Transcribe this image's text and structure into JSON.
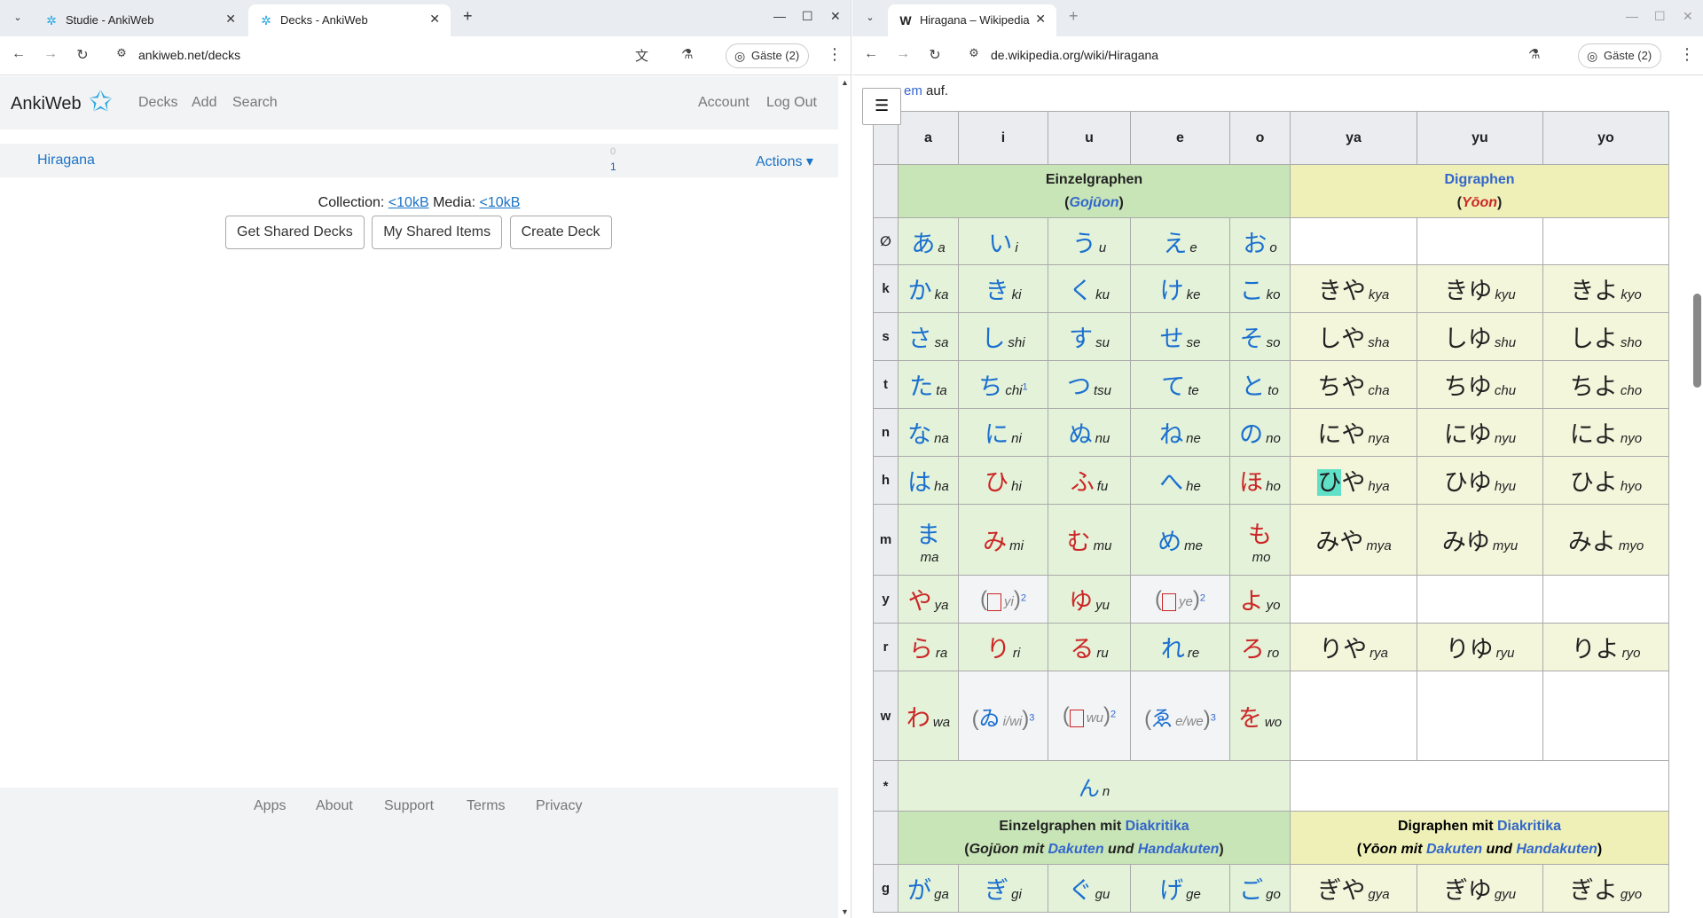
{
  "left_window": {
    "tabs": [
      {
        "title": "Studie - AnkiWeb",
        "active": false
      },
      {
        "title": "Decks - AnkiWeb",
        "active": true
      }
    ],
    "url": "ankiweb.net/decks",
    "profile": "Gäste (2)",
    "nav": {
      "logo": "AnkiWeb",
      "links": [
        "Decks",
        "Add",
        "Search"
      ],
      "right": [
        "Account",
        "Log Out"
      ]
    },
    "deck": {
      "name": "Hiragana",
      "count_top": "0",
      "count_bottom": "1",
      "actions": "Actions ▾"
    },
    "collection": {
      "label_collection": "Collection:",
      "collection_size": "<10kB",
      "label_media": "Media:",
      "media_size": "<10kB"
    },
    "buttons": [
      "Get Shared Decks",
      "My Shared Items",
      "Create Deck"
    ],
    "footer": [
      "Apps",
      "About",
      "Support",
      "Terms",
      "Privacy"
    ]
  },
  "right_window": {
    "tab": {
      "title": "Hiragana – Wikipedia"
    },
    "url": "de.wikipedia.org/wiki/Hiragana",
    "profile": "Gäste (2)",
    "pre_text_link": "em",
    "pre_text": " auf.",
    "table": {
      "columns": [
        "a",
        "i",
        "u",
        "e",
        "o",
        "ya",
        "yu",
        "yo"
      ],
      "group1": {
        "title": "Einzelgraphen",
        "sub": "Gojūon"
      },
      "group2": {
        "title": "Digraphen",
        "sub": "Yōon"
      },
      "rows": [
        {
          "label": "∅",
          "cells": [
            [
              "あ",
              "a",
              "b"
            ],
            [
              "い",
              "i",
              "b"
            ],
            [
              "う",
              "u",
              "b"
            ],
            [
              "え",
              "e",
              "b"
            ],
            [
              "お",
              "o",
              "b"
            ],
            null,
            null,
            null
          ]
        },
        {
          "label": "k",
          "cells": [
            [
              "か",
              "ka",
              "b"
            ],
            [
              "き",
              "ki",
              "b"
            ],
            [
              "く",
              "ku",
              "b"
            ],
            [
              "け",
              "ke",
              "b"
            ],
            [
              "こ",
              "ko",
              "b"
            ],
            [
              "きや",
              "kya",
              "k"
            ],
            [
              "きゆ",
              "kyu",
              "k"
            ],
            [
              "きよ",
              "kyo",
              "k"
            ]
          ]
        },
        {
          "label": "s",
          "cells": [
            [
              "さ",
              "sa",
              "b"
            ],
            [
              "し",
              "shi",
              "b"
            ],
            [
              "す",
              "su",
              "b"
            ],
            [
              "せ",
              "se",
              "b"
            ],
            [
              "そ",
              "so",
              "b"
            ],
            [
              "しや",
              "sha",
              "k"
            ],
            [
              "しゆ",
              "shu",
              "k"
            ],
            [
              "しよ",
              "sho",
              "k"
            ]
          ]
        },
        {
          "label": "t",
          "cells": [
            [
              "た",
              "ta",
              "b"
            ],
            [
              "ち",
              "chi",
              "b"
            ],
            [
              "つ",
              "tsu",
              "b"
            ],
            [
              "て",
              "te",
              "b"
            ],
            [
              "と",
              "to",
              "b"
            ],
            [
              "ちや",
              "cha",
              "k"
            ],
            [
              "ちゆ",
              "chu",
              "k"
            ],
            [
              "ちよ",
              "cho",
              "k"
            ]
          ]
        },
        {
          "label": "n",
          "cells": [
            [
              "な",
              "na",
              "b"
            ],
            [
              "に",
              "ni",
              "b"
            ],
            [
              "ぬ",
              "nu",
              "b"
            ],
            [
              "ね",
              "ne",
              "b"
            ],
            [
              "の",
              "no",
              "b"
            ],
            [
              "にや",
              "nya",
              "k"
            ],
            [
              "にゆ",
              "nyu",
              "k"
            ],
            [
              "によ",
              "nyo",
              "k"
            ]
          ]
        },
        {
          "label": "h",
          "cells": [
            [
              "は",
              "ha",
              "b"
            ],
            [
              "ひ",
              "hi",
              "r"
            ],
            [
              "ふ",
              "fu",
              "r"
            ],
            [
              "へ",
              "he",
              "b"
            ],
            [
              "ほ",
              "ho",
              "r"
            ],
            [
              "ひや",
              "hya",
              "k"
            ],
            [
              "ひゆ",
              "hyu",
              "k"
            ],
            [
              "ひよ",
              "hyo",
              "k"
            ]
          ]
        },
        {
          "label": "m",
          "cells": [
            [
              "ま",
              "ma",
              "b"
            ],
            [
              "み",
              "mi",
              "r"
            ],
            [
              "む",
              "mu",
              "r"
            ],
            [
              "め",
              "me",
              "b"
            ],
            [
              "も",
              "mo",
              "r"
            ],
            [
              "みや",
              "mya",
              "k"
            ],
            [
              "みゆ",
              "myu",
              "k"
            ],
            [
              "みよ",
              "myo",
              "k"
            ]
          ]
        },
        {
          "label": "y",
          "cells": [
            [
              "や",
              "ya",
              "r"
            ],
            [
              "yi",
              "yi",
              "g"
            ],
            [
              "ゆ",
              "yu",
              "r"
            ],
            [
              "ye",
              "ye",
              "g"
            ],
            [
              "よ",
              "yo",
              "r"
            ],
            null,
            null,
            null
          ]
        },
        {
          "label": "r",
          "cells": [
            [
              "ら",
              "ra",
              "r"
            ],
            [
              "り",
              "ri",
              "r"
            ],
            [
              "る",
              "ru",
              "r"
            ],
            [
              "れ",
              "re",
              "b"
            ],
            [
              "ろ",
              "ro",
              "r"
            ],
            [
              "りや",
              "rya",
              "k"
            ],
            [
              "りゆ",
              "ryu",
              "k"
            ],
            [
              "りよ",
              "ryo",
              "k"
            ]
          ]
        },
        {
          "label": "w",
          "cells": [
            [
              "わ",
              "wa",
              "r"
            ],
            [
              "ゐ",
              "i/wi",
              "g"
            ],
            [
              "wu",
              "wu",
              "g"
            ],
            [
              "ゑ",
              "e/we",
              "g"
            ],
            [
              "を",
              "wo",
              "r"
            ],
            null,
            null,
            null
          ]
        }
      ],
      "n_row": {
        "label": "*",
        "kana": "ん",
        "roma": "n"
      },
      "group3": {
        "title": "Einzelgraphen mit",
        "title_link": "Diakritika",
        "sub_a": "Gojūon",
        "sub_mit": " mit ",
        "sub_link1": "Dakuten",
        "sub_und": " und ",
        "sub_link2": "Handakuten"
      },
      "group4": {
        "title": "Digraphen mit",
        "title_link": "Diakritika",
        "sub_a": "Yōon",
        "sub_mit": " mit ",
        "sub_link1": "Dakuten",
        "sub_und": " und ",
        "sub_link2": "Handakuten"
      },
      "g_row": {
        "label": "g",
        "cells": [
          [
            "が",
            "ga"
          ],
          [
            "ぎ",
            "gi"
          ],
          [
            "ぐ",
            "gu"
          ],
          [
            "げ",
            "ge"
          ],
          [
            "ご",
            "go"
          ],
          [
            "ぎや",
            "gya"
          ],
          [
            "ぎゆ",
            "gyu"
          ],
          [
            "ぎよ",
            "gyo"
          ]
        ]
      },
      "footnotes": {
        "chi": "1",
        "yi": "2",
        "ye": "2",
        "wu": "2",
        "wi": "3",
        "we": "3"
      }
    }
  }
}
